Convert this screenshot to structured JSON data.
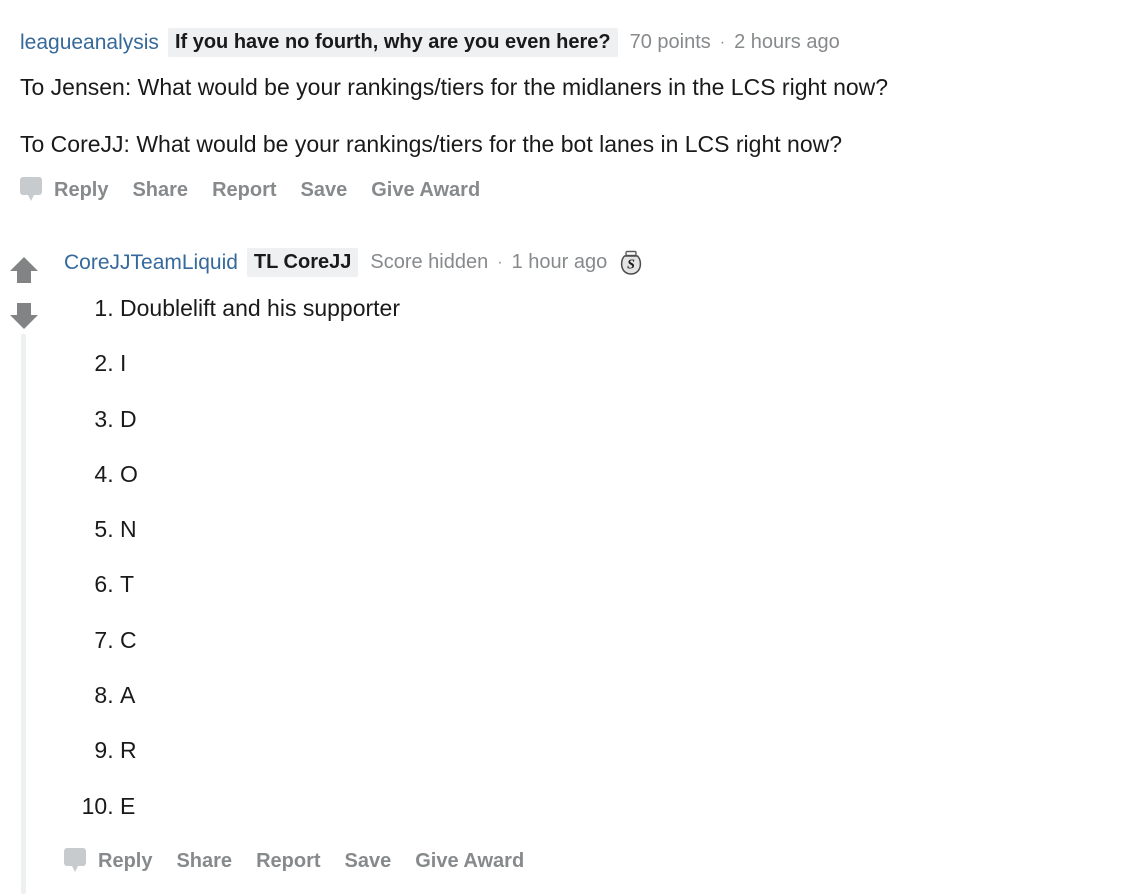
{
  "comments": [
    {
      "author": "leagueanalysis",
      "flair": "If you have no fourth, why are you even here?",
      "score": "70 points",
      "separator": "·",
      "timestamp": "2 hours ago",
      "paragraphs": [
        "To Jensen: What would be your rankings/tiers for the midlaners in the LCS right now?",
        "To CoreJJ: What would be your rankings/tiers for the bot lanes in LCS right now?"
      ],
      "actions": {
        "reply": "Reply",
        "share": "Share",
        "report": "Report",
        "save": "Save",
        "give_award": "Give Award"
      }
    },
    {
      "author": "CoreJJTeamLiquid",
      "flair": "TL CoreJJ",
      "score": "Score hidden",
      "separator": "·",
      "timestamp": "1 hour ago",
      "award_letter": "S",
      "list_items": [
        "Doublelift and his supporter",
        "I",
        "D",
        "O",
        "N",
        "T",
        "C",
        "A",
        "R",
        "E"
      ],
      "actions": {
        "reply": "Reply",
        "share": "Share",
        "report": "Report",
        "save": "Save",
        "give_award": "Give Award"
      }
    }
  ],
  "colors": {
    "author_link": "#36699b",
    "meta_gray": "#878a8c",
    "flair_bg": "#eef0f1",
    "thread_line": "#edeff1",
    "body_text": "#1a1a1b",
    "vote_arrow": "#818384"
  }
}
